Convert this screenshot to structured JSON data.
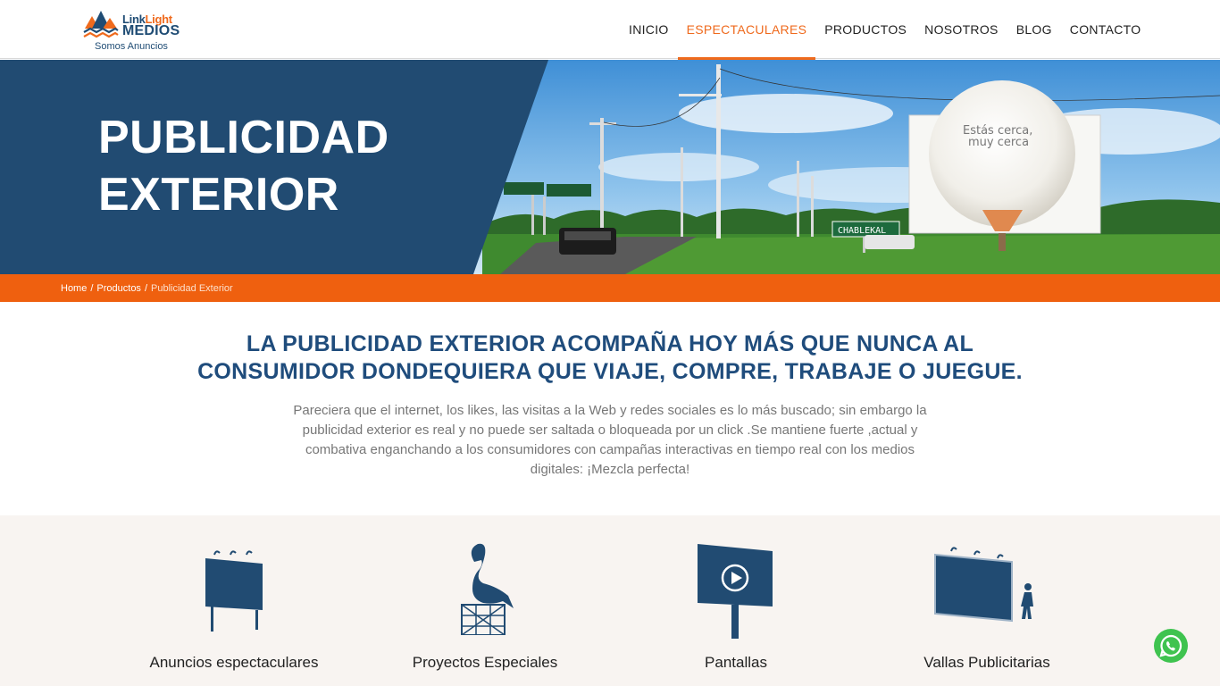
{
  "logo": {
    "word_link": "Link",
    "word_light": "Light",
    "word_medios": "MEDIOS",
    "tagline": "Somos Anuncios"
  },
  "nav": [
    {
      "label": "INICIO"
    },
    {
      "label": "ESPECTACULARES"
    },
    {
      "label": "PRODUCTOS"
    },
    {
      "label": "NOSOTROS"
    },
    {
      "label": "BLOG"
    },
    {
      "label": "CONTACTO"
    }
  ],
  "hero": {
    "title_line1": "PUBLICIDAD",
    "title_line2": "EXTERIOR",
    "billboard_line1": "Estás cerca,",
    "billboard_line2": "muy cerca",
    "road_sign": "CHABLEKAL"
  },
  "breadcrumb": {
    "home": "Home",
    "products": "Productos",
    "current": "Publicidad Exterior",
    "separator": "/"
  },
  "intro": {
    "heading_line1": "LA PUBLICIDAD EXTERIOR ACOMPAÑA HOY MÁS QUE NUNCA AL",
    "heading_line2": "CONSUMIDOR DONDEQUIERA QUE VIAJE, COMPRE, TRABAJE O JUEGUE.",
    "body": "Pareciera que el internet, los likes, las visitas a la Web y redes sociales es lo más buscado; sin embargo la publicidad exterior es real y no puede ser saltada o bloqueada por un click .Se mantiene fuerte ,actual y combativa enganchando a los consumidores con campañas interactivas en tiempo real con los medios digitales: ¡Mezcla perfecta!"
  },
  "products": [
    {
      "label": "Anuncios espectaculares",
      "icon": "billboard-icon"
    },
    {
      "label": "Proyectos Especiales",
      "icon": "flamingo-icon"
    },
    {
      "label": "Pantallas",
      "icon": "screen-play-icon"
    },
    {
      "label": "Vallas Publicitarias",
      "icon": "wall-billboard-icon"
    }
  ],
  "colors": {
    "brand_blue": "#1f4c7c",
    "brand_orange": "#ef600f",
    "hero_panel": "#214b72",
    "whatsapp": "#3fc34f"
  }
}
